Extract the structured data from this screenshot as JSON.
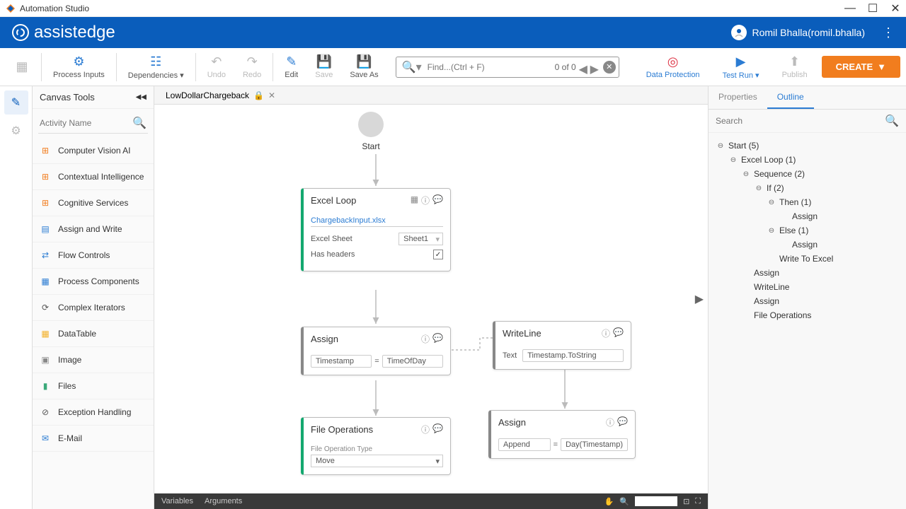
{
  "titlebar": {
    "title": "Automation Studio"
  },
  "header": {
    "logo_text": "assistedge",
    "user_name": "Romil Bhalla(romil.bhalla)"
  },
  "toolbar": {
    "process_inputs": "Process Inputs",
    "dependencies": "Dependencies",
    "undo": "Undo",
    "redo": "Redo",
    "edit": "Edit",
    "save": "Save",
    "save_as": "Save As",
    "find_placeholder": "Find...(Ctrl + F)",
    "find_count": "0 of 0",
    "data_protection": "Data Protection",
    "test_run": "Test Run",
    "publish": "Publish",
    "create": "CREATE"
  },
  "tools_panel": {
    "title": "Canvas Tools",
    "search_placeholder": "Activity Name",
    "items": [
      "Computer Vision AI",
      "Contextual Intelligence",
      "Cognitive Services",
      "Assign and Write",
      "Flow Controls",
      "Process Components",
      "Complex Iterators",
      "DataTable",
      "Image",
      "Files",
      "Exception Handling",
      "E-Mail"
    ]
  },
  "tab": {
    "name": "LowDollarChargeback"
  },
  "canvas": {
    "start": "Start",
    "excel_loop": {
      "title": "Excel Loop",
      "file": "ChargebackInput.xlsx",
      "sheet_label": "Excel Sheet",
      "sheet_value": "Sheet1",
      "headers_label": "Has headers"
    },
    "assign1": {
      "title": "Assign",
      "left": "Timestamp",
      "right": "TimeOfDay"
    },
    "writeline": {
      "title": "WriteLine",
      "text_label": "Text",
      "text_value": "Timestamp.ToString"
    },
    "assign2": {
      "title": "Assign",
      "left": "Append",
      "right": "Day(Timestamp)"
    },
    "fileops": {
      "title": "File Operations",
      "type_label": "File Operation Type",
      "type_value": "Move"
    }
  },
  "bottom": {
    "variables": "Variables",
    "arguments": "Arguments"
  },
  "props": {
    "tab_properties": "Properties",
    "tab_outline": "Outline",
    "search_placeholder": "Search",
    "tree": {
      "start": "Start (5)",
      "excel_loop": "Excel Loop (1)",
      "sequence": "Sequence (2)",
      "if": "If (2)",
      "then": "Then (1)",
      "assign_then": "Assign",
      "else": "Else (1)",
      "assign_else": "Assign",
      "write_excel": "Write To Excel",
      "assign": "Assign",
      "writeline": "WriteLine",
      "assign2": "Assign",
      "fileops": "File Operations"
    }
  }
}
